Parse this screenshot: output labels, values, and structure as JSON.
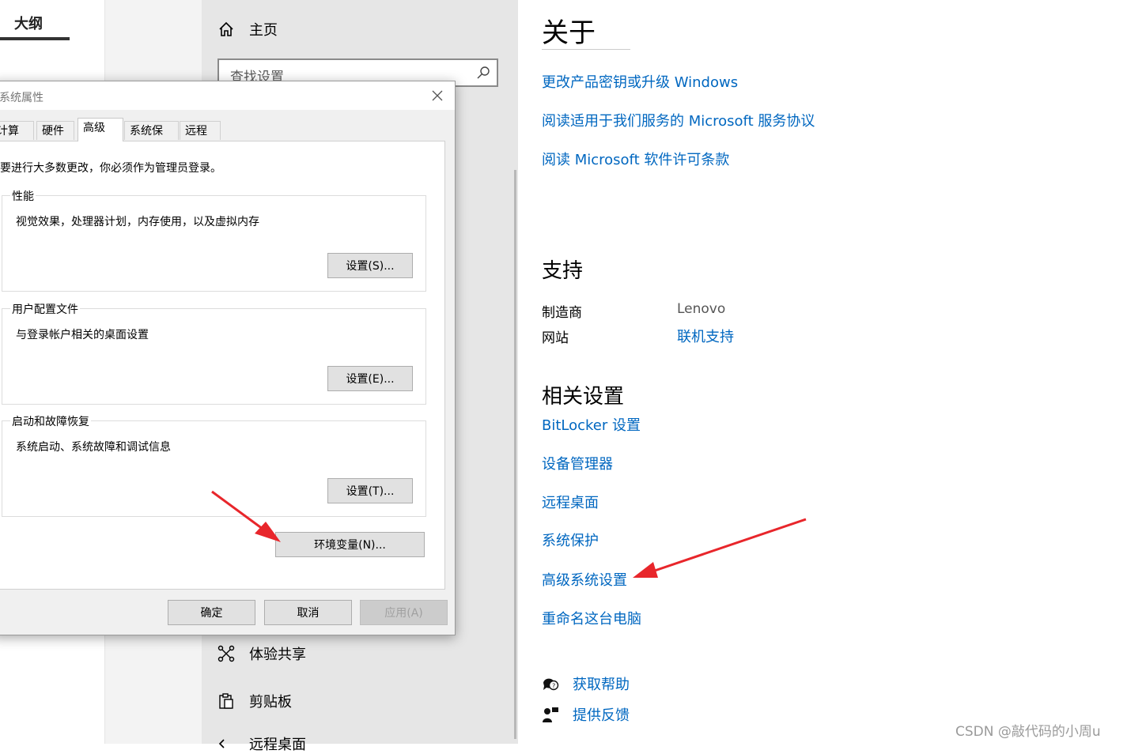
{
  "outline": {
    "title": "大纲"
  },
  "nav": {
    "home": "主页",
    "search_placeholder": "查找设置",
    "items": [
      "体验共享",
      "剪贴板",
      "远程桌面"
    ]
  },
  "about": {
    "heading": "关于",
    "links": [
      "更改产品密钥或升级 Windows",
      "阅读适用于我们服务的 Microsoft 服务协议",
      "阅读 Microsoft 软件许可条款"
    ]
  },
  "support": {
    "heading": "支持",
    "manufacturer_label": "制造商",
    "manufacturer_value": "Lenovo",
    "website_label": "网站",
    "website_value": "联机支持"
  },
  "related": {
    "heading": "相关设置",
    "links": [
      "BitLocker 设置",
      "设备管理器",
      "远程桌面",
      "系统保护",
      "高级系统设置",
      "重命名这台电脑"
    ]
  },
  "help": {
    "get_help": "获取帮助",
    "feedback": "提供反馈"
  },
  "dialog": {
    "title": "系统属性",
    "tabs": [
      "计算机名",
      "硬件",
      "高级",
      "系统保护",
      "远程"
    ],
    "active_tab": "高级",
    "admin_note": "要进行大多数更改，你必须作为管理员登录。",
    "performance": {
      "legend": "性能",
      "desc": "视觉效果，处理器计划，内存使用，以及虚拟内存",
      "button": "设置(S)..."
    },
    "profiles": {
      "legend": "用户配置文件",
      "desc": "与登录帐户相关的桌面设置",
      "button": "设置(E)..."
    },
    "startup": {
      "legend": "启动和故障恢复",
      "desc": "系统启动、系统故障和调试信息",
      "button": "设置(T)..."
    },
    "env_button": "环境变量(N)...",
    "ok": "确定",
    "cancel": "取消",
    "apply": "应用(A)"
  },
  "watermark": "CSDN @敲代码的小周u",
  "colors": {
    "link": "#0067c0",
    "arrow": "#e8262b",
    "nav_bg": "#e6e6e6"
  }
}
